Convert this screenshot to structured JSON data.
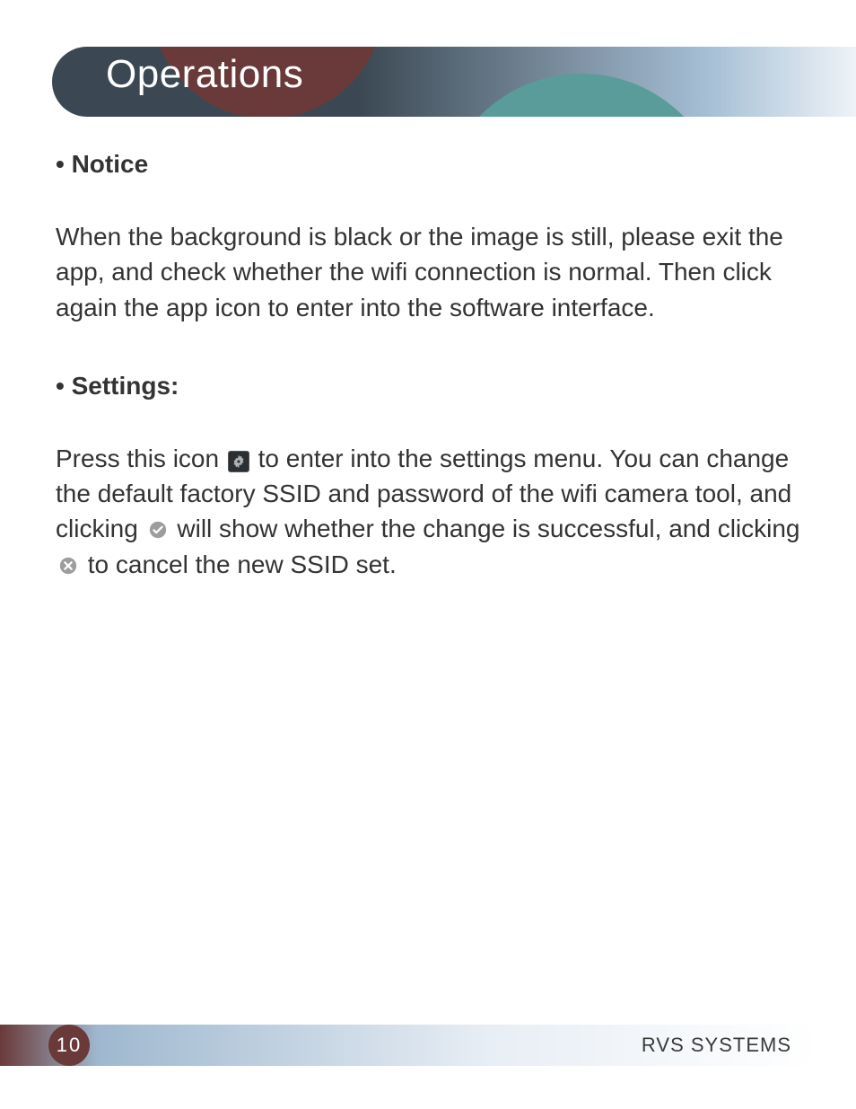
{
  "header": {
    "title": "Operations"
  },
  "sections": {
    "notice": {
      "heading": "• Notice",
      "body": "When the background is black or the image is still, please exit the app, and check whether the wifi connection is normal. Then click again the app icon to enter into the software interface."
    },
    "settings": {
      "heading": "• Settings:",
      "p1_a": "Press this icon ",
      "p1_b": " to enter into the settings menu. You can change the default factory SSID and password of the wifi camera tool, and clicking ",
      "p1_c": " will show whether the change is successful, and clicking ",
      "p1_d": " to cancel the new SSID set."
    }
  },
  "footer": {
    "page_number": "10",
    "brand": "RVS SYSTEMS"
  }
}
